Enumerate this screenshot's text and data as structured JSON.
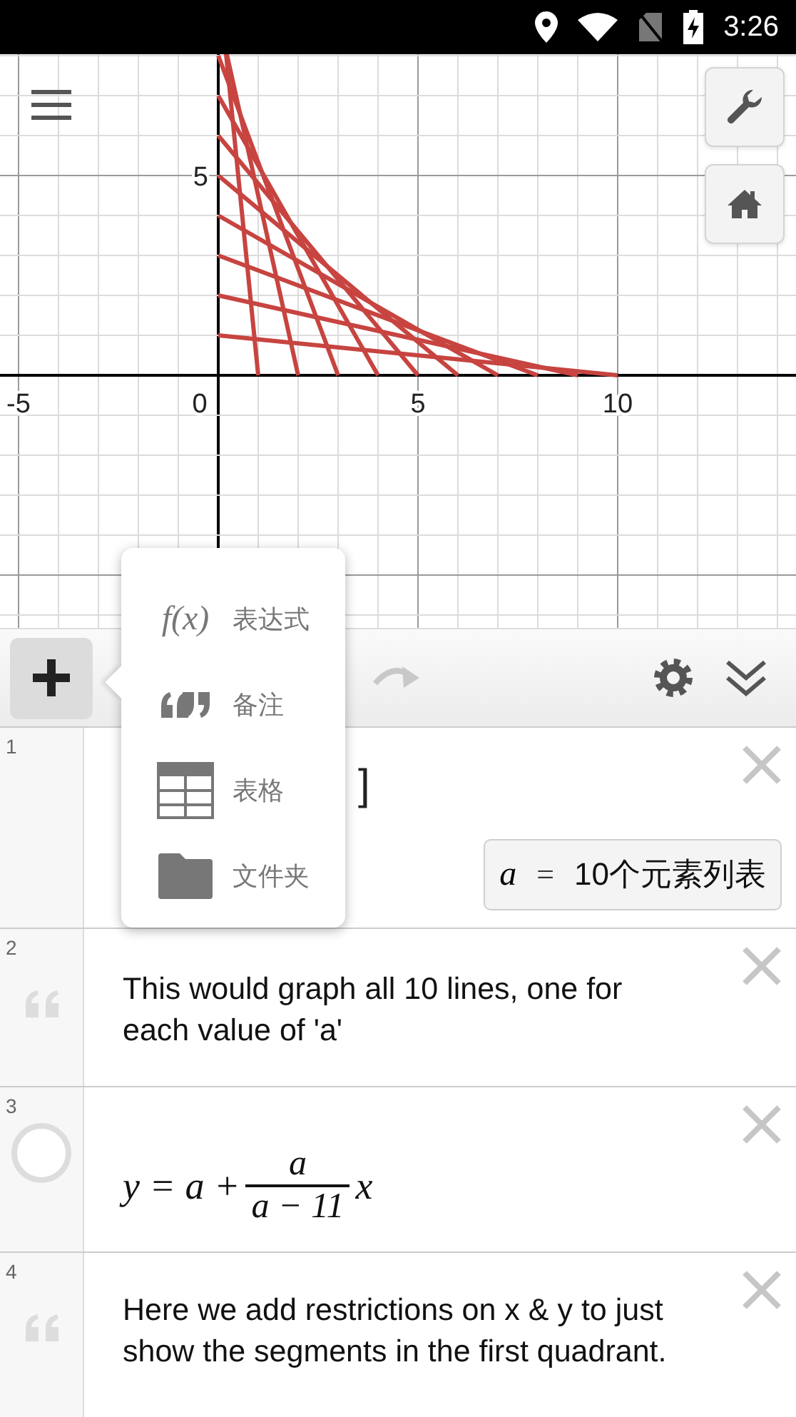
{
  "status_bar": {
    "time": "3:26"
  },
  "graph": {
    "x_axis_labels": [
      "-5",
      "0",
      "5",
      "10"
    ],
    "y_axis_labels": [
      "5"
    ]
  },
  "add_menu": {
    "items": [
      {
        "kind": "expression",
        "icon_text": "f(x)",
        "label": "表达式"
      },
      {
        "kind": "note",
        "label": "备注"
      },
      {
        "kind": "table",
        "label": "表格"
      },
      {
        "kind": "folder",
        "label": "文件夹"
      }
    ]
  },
  "expressions": [
    {
      "index": "1",
      "kind": "expression",
      "text": "]",
      "slider": {
        "variable": "a",
        "operator": "=",
        "value": "10个元素列表"
      }
    },
    {
      "index": "2",
      "kind": "note",
      "text": "This would graph all 10 lines, one for each value of 'a'"
    },
    {
      "index": "3",
      "kind": "expression",
      "hidden": true,
      "math": {
        "before": "y = a +",
        "numerator": "a",
        "denominator": "a − 11",
        "after": "x"
      }
    },
    {
      "index": "4",
      "kind": "note",
      "text": "Here we add restrictions on x & y to just show the segments in the first quadrant."
    }
  ]
}
